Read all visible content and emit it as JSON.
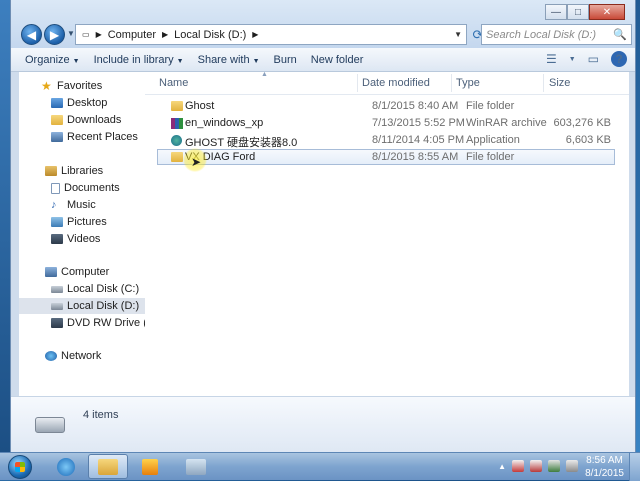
{
  "window": {
    "address": [
      "Computer",
      "Local Disk (D:)"
    ],
    "search_placeholder": "Search Local Disk (D:)",
    "caption": {
      "minimize": "—",
      "maximize": "□",
      "close": "✕"
    },
    "nav": {
      "back": "◀",
      "forward": "▶",
      "refresh": "⟳",
      "search_icon": "🔍"
    }
  },
  "toolbar": {
    "organize": "Organize",
    "include": "Include in library",
    "share": "Share with",
    "burn": "Burn",
    "new_folder": "New folder",
    "help": "?"
  },
  "sidebar": {
    "favorites": "Favorites",
    "desktop": "Desktop",
    "downloads": "Downloads",
    "recent": "Recent Places",
    "libraries": "Libraries",
    "documents": "Documents",
    "music": "Music",
    "pictures": "Pictures",
    "videos": "Videos",
    "computer": "Computer",
    "drive_c": "Local Disk (C:)",
    "drive_d": "Local Disk (D:)",
    "drive_e": "DVD RW Drive (E:) Fo",
    "network": "Network"
  },
  "columns": {
    "name": "Name",
    "date": "Date modified",
    "type": "Type",
    "size": "Size"
  },
  "files": [
    {
      "name": "Ghost",
      "date": "8/1/2015 8:40 AM",
      "type": "File folder",
      "size": "",
      "icon": "folder-icon"
    },
    {
      "name": "en_windows_xp",
      "date": "7/13/2015 5:52 PM",
      "type": "WinRAR archive",
      "size": "603,276 KB",
      "icon": "winrar-icon"
    },
    {
      "name": "GHOST 硬盘安装器8.0",
      "date": "8/11/2014 4:05 PM",
      "type": "Application",
      "size": "6,603 KB",
      "icon": "application-icon"
    },
    {
      "name": "VX DIAG Ford",
      "date": "8/1/2015 8:55 AM",
      "type": "File folder",
      "size": "",
      "icon": "folder-icon"
    }
  ],
  "status": {
    "item_count": "4 items"
  },
  "taskbar": {
    "time": "8:56 AM",
    "date": "8/1/2015"
  },
  "colors": {
    "selection_border": "#a7bcd8",
    "accent": "#2e67b2"
  }
}
